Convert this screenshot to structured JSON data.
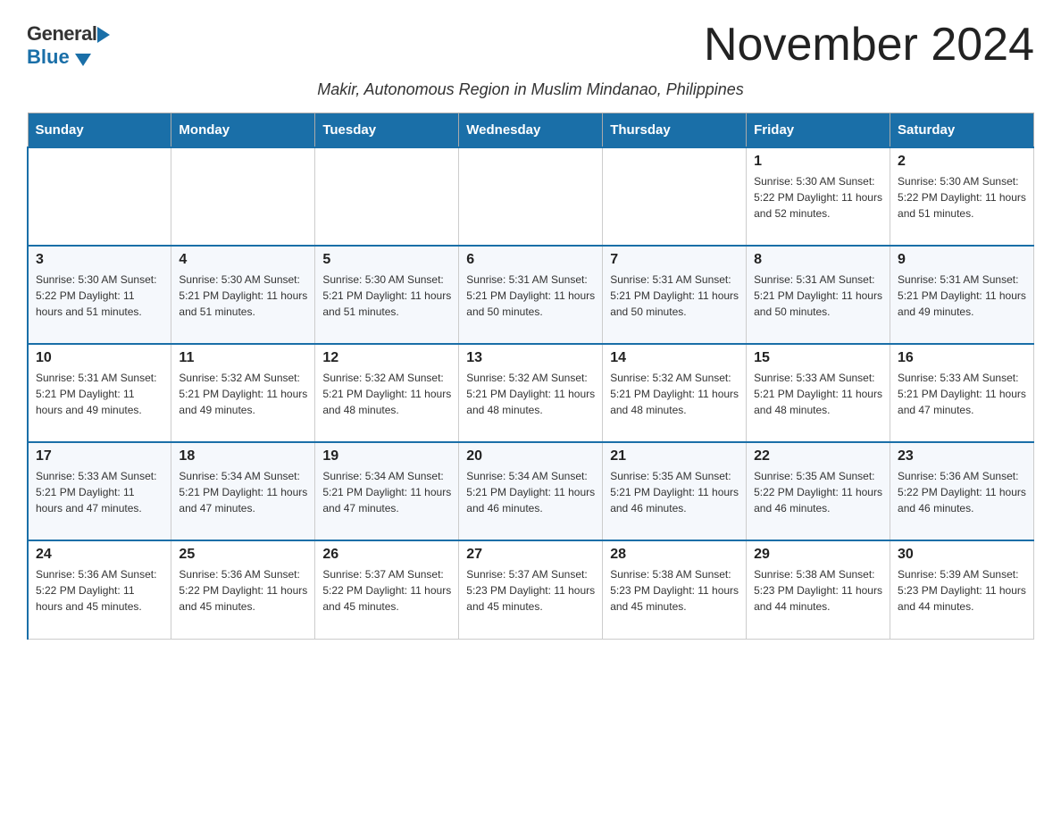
{
  "logo": {
    "general": "General",
    "blue": "Blue"
  },
  "title": "November 2024",
  "subtitle": "Makir, Autonomous Region in Muslim Mindanao, Philippines",
  "weekdays": [
    "Sunday",
    "Monday",
    "Tuesday",
    "Wednesday",
    "Thursday",
    "Friday",
    "Saturday"
  ],
  "weeks": [
    [
      {
        "day": "",
        "info": ""
      },
      {
        "day": "",
        "info": ""
      },
      {
        "day": "",
        "info": ""
      },
      {
        "day": "",
        "info": ""
      },
      {
        "day": "",
        "info": ""
      },
      {
        "day": "1",
        "info": "Sunrise: 5:30 AM\nSunset: 5:22 PM\nDaylight: 11 hours\nand 52 minutes."
      },
      {
        "day": "2",
        "info": "Sunrise: 5:30 AM\nSunset: 5:22 PM\nDaylight: 11 hours\nand 51 minutes."
      }
    ],
    [
      {
        "day": "3",
        "info": "Sunrise: 5:30 AM\nSunset: 5:22 PM\nDaylight: 11 hours\nand 51 minutes."
      },
      {
        "day": "4",
        "info": "Sunrise: 5:30 AM\nSunset: 5:21 PM\nDaylight: 11 hours\nand 51 minutes."
      },
      {
        "day": "5",
        "info": "Sunrise: 5:30 AM\nSunset: 5:21 PM\nDaylight: 11 hours\nand 51 minutes."
      },
      {
        "day": "6",
        "info": "Sunrise: 5:31 AM\nSunset: 5:21 PM\nDaylight: 11 hours\nand 50 minutes."
      },
      {
        "day": "7",
        "info": "Sunrise: 5:31 AM\nSunset: 5:21 PM\nDaylight: 11 hours\nand 50 minutes."
      },
      {
        "day": "8",
        "info": "Sunrise: 5:31 AM\nSunset: 5:21 PM\nDaylight: 11 hours\nand 50 minutes."
      },
      {
        "day": "9",
        "info": "Sunrise: 5:31 AM\nSunset: 5:21 PM\nDaylight: 11 hours\nand 49 minutes."
      }
    ],
    [
      {
        "day": "10",
        "info": "Sunrise: 5:31 AM\nSunset: 5:21 PM\nDaylight: 11 hours\nand 49 minutes."
      },
      {
        "day": "11",
        "info": "Sunrise: 5:32 AM\nSunset: 5:21 PM\nDaylight: 11 hours\nand 49 minutes."
      },
      {
        "day": "12",
        "info": "Sunrise: 5:32 AM\nSunset: 5:21 PM\nDaylight: 11 hours\nand 48 minutes."
      },
      {
        "day": "13",
        "info": "Sunrise: 5:32 AM\nSunset: 5:21 PM\nDaylight: 11 hours\nand 48 minutes."
      },
      {
        "day": "14",
        "info": "Sunrise: 5:32 AM\nSunset: 5:21 PM\nDaylight: 11 hours\nand 48 minutes."
      },
      {
        "day": "15",
        "info": "Sunrise: 5:33 AM\nSunset: 5:21 PM\nDaylight: 11 hours\nand 48 minutes."
      },
      {
        "day": "16",
        "info": "Sunrise: 5:33 AM\nSunset: 5:21 PM\nDaylight: 11 hours\nand 47 minutes."
      }
    ],
    [
      {
        "day": "17",
        "info": "Sunrise: 5:33 AM\nSunset: 5:21 PM\nDaylight: 11 hours\nand 47 minutes."
      },
      {
        "day": "18",
        "info": "Sunrise: 5:34 AM\nSunset: 5:21 PM\nDaylight: 11 hours\nand 47 minutes."
      },
      {
        "day": "19",
        "info": "Sunrise: 5:34 AM\nSunset: 5:21 PM\nDaylight: 11 hours\nand 47 minutes."
      },
      {
        "day": "20",
        "info": "Sunrise: 5:34 AM\nSunset: 5:21 PM\nDaylight: 11 hours\nand 46 minutes."
      },
      {
        "day": "21",
        "info": "Sunrise: 5:35 AM\nSunset: 5:21 PM\nDaylight: 11 hours\nand 46 minutes."
      },
      {
        "day": "22",
        "info": "Sunrise: 5:35 AM\nSunset: 5:22 PM\nDaylight: 11 hours\nand 46 minutes."
      },
      {
        "day": "23",
        "info": "Sunrise: 5:36 AM\nSunset: 5:22 PM\nDaylight: 11 hours\nand 46 minutes."
      }
    ],
    [
      {
        "day": "24",
        "info": "Sunrise: 5:36 AM\nSunset: 5:22 PM\nDaylight: 11 hours\nand 45 minutes."
      },
      {
        "day": "25",
        "info": "Sunrise: 5:36 AM\nSunset: 5:22 PM\nDaylight: 11 hours\nand 45 minutes."
      },
      {
        "day": "26",
        "info": "Sunrise: 5:37 AM\nSunset: 5:22 PM\nDaylight: 11 hours\nand 45 minutes."
      },
      {
        "day": "27",
        "info": "Sunrise: 5:37 AM\nSunset: 5:23 PM\nDaylight: 11 hours\nand 45 minutes."
      },
      {
        "day": "28",
        "info": "Sunrise: 5:38 AM\nSunset: 5:23 PM\nDaylight: 11 hours\nand 45 minutes."
      },
      {
        "day": "29",
        "info": "Sunrise: 5:38 AM\nSunset: 5:23 PM\nDaylight: 11 hours\nand 44 minutes."
      },
      {
        "day": "30",
        "info": "Sunrise: 5:39 AM\nSunset: 5:23 PM\nDaylight: 11 hours\nand 44 minutes."
      }
    ]
  ]
}
